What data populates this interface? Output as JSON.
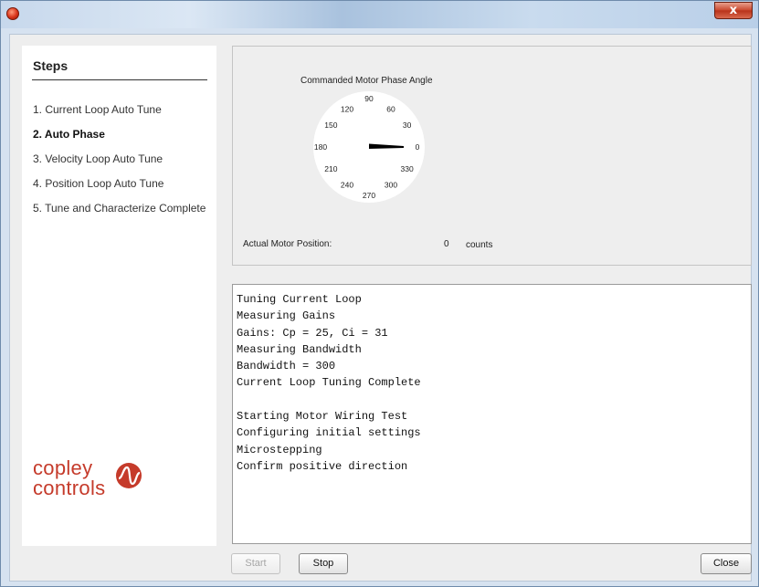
{
  "window": {
    "close_glyph": "x"
  },
  "steps": {
    "title": "Steps",
    "items": [
      {
        "label": "1. Current Loop Auto Tune",
        "active": false
      },
      {
        "label": "2. Auto Phase",
        "active": true
      },
      {
        "label": "3. Velocity Loop Auto Tune",
        "active": false
      },
      {
        "label": "4. Position Loop Auto Tune",
        "active": false
      },
      {
        "label": "5. Tune and Characterize Complete",
        "active": false
      }
    ]
  },
  "logo": {
    "line1": "copley",
    "line2": "controls",
    "color": "#c53b2b"
  },
  "phase": {
    "title": "Commanded Motor Phase Angle",
    "dial_labels": [
      "0",
      "30",
      "60",
      "90",
      "120",
      "150",
      "180",
      "210",
      "240",
      "270",
      "300",
      "330"
    ],
    "needle_angle_deg": 0,
    "position_label": "Actual Motor Position:",
    "position_value": "0",
    "position_unit": "counts"
  },
  "log": {
    "lines": [
      "Tuning Current Loop",
      "Measuring Gains",
      "Gains: Cp = 25, Ci = 31",
      "Measuring Bandwidth",
      "Bandwidth = 300",
      "Current Loop Tuning Complete",
      "",
      "Starting Motor Wiring Test",
      "Configuring initial settings",
      "Microstepping",
      "Confirm positive direction"
    ]
  },
  "buttons": {
    "start": "Start",
    "stop": "Stop",
    "close": "Close"
  }
}
